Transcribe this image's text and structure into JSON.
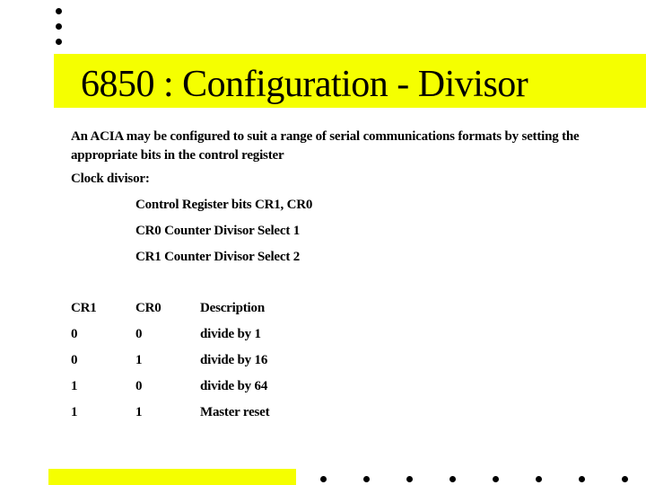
{
  "slide": {
    "title": "6850 : Configuration - Divisor",
    "intro": "An ACIA may be configured to suit a range of serial communications formats by setting the appropriate bits in the control register",
    "clock_heading": "Clock divisor:",
    "sub_items": [
      "Control Register bits CR1, CR0",
      "CR0 Counter Divisor Select 1",
      "CR1 Counter Divisor Select 2"
    ],
    "table": {
      "headers": [
        "CR1",
        "CR0",
        "Description"
      ],
      "rows": [
        [
          "0",
          "0",
          "divide by 1"
        ],
        [
          "0",
          "1",
          "divide by 16"
        ],
        [
          "1",
          "0",
          "divide by 64"
        ],
        [
          "1",
          "1",
          "Master reset"
        ]
      ]
    },
    "accent_color": "#f5ff00"
  }
}
